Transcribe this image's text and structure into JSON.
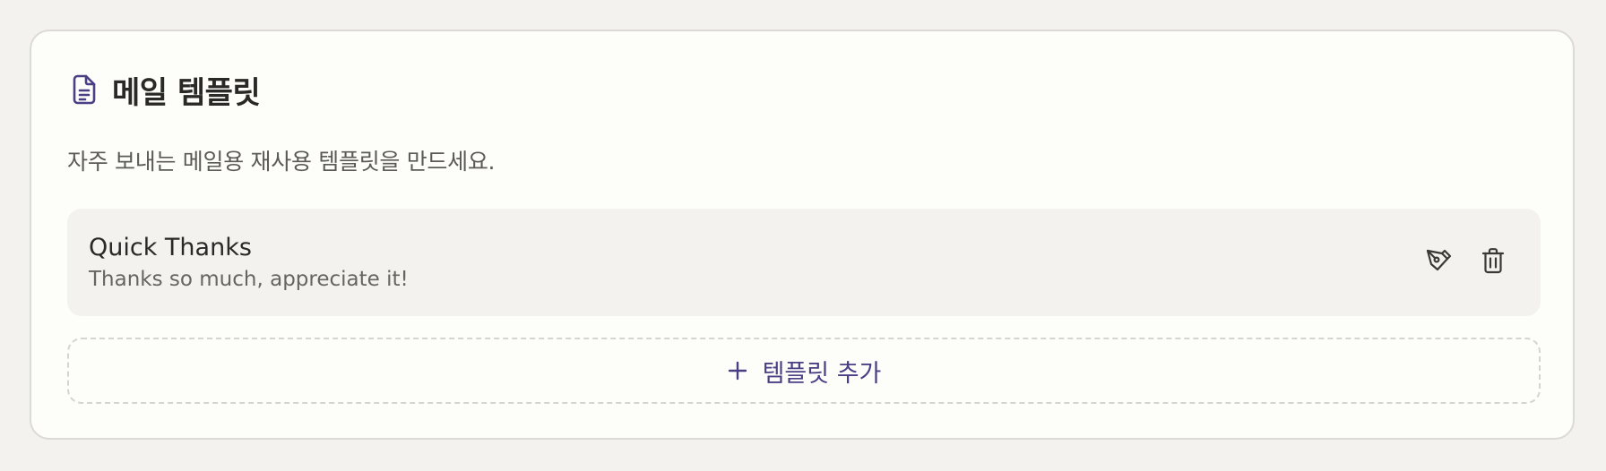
{
  "card": {
    "title": "메일 템플릿",
    "title_icon": "document-icon",
    "description": "자주 보내는 메일용 재사용 템플릿을 만드세요."
  },
  "templates": [
    {
      "name": "Quick Thanks",
      "preview": "Thanks so much, appreciate it!",
      "actions": [
        "pen-icon",
        "trash-icon"
      ]
    }
  ],
  "add_button": {
    "icon": "plus-icon",
    "label": "템플릿 추가"
  },
  "colors": {
    "accent": "#4a3f85",
    "page_background": "#f3f2ef",
    "card_background": "#fdfdf9",
    "item_background": "#f3f2ef"
  }
}
